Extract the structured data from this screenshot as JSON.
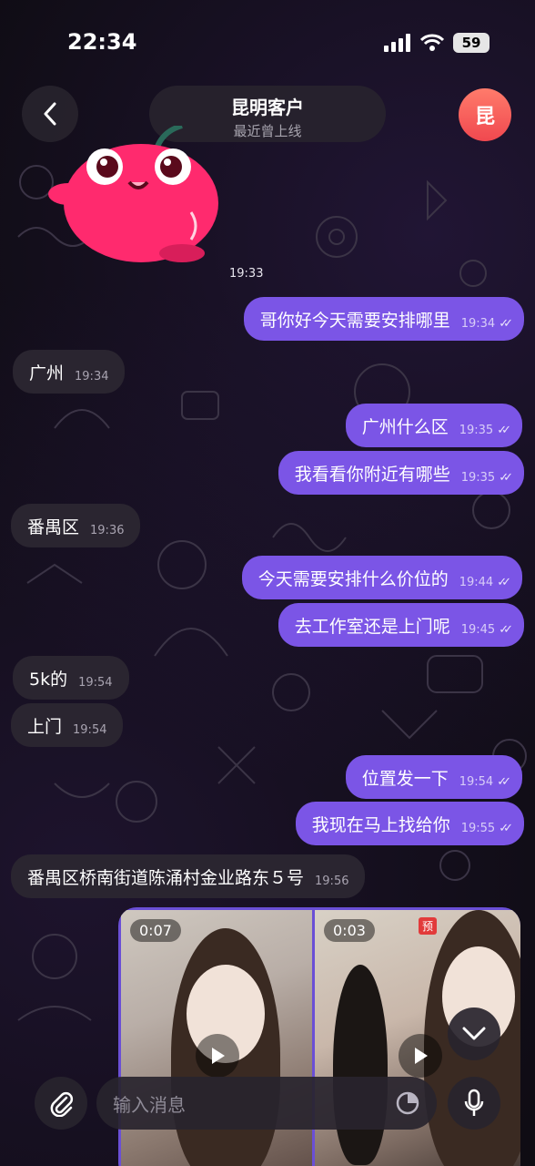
{
  "status_bar": {
    "time": "22:34",
    "battery": "59"
  },
  "header": {
    "title": "昆明客户",
    "subtitle": "最近曾上线",
    "avatar_letter": "昆"
  },
  "sticker": {
    "time": "19:33"
  },
  "messages": [
    {
      "dir": "out",
      "text": "哥你好今天需要安排哪里",
      "time": "19:34"
    },
    {
      "dir": "in",
      "text": "广州",
      "time": "19:34"
    },
    {
      "dir": "out",
      "text": "广州什么区",
      "time": "19:35"
    },
    {
      "dir": "out",
      "text": "我看看你附近有哪些",
      "time": "19:35"
    },
    {
      "dir": "in",
      "text": "番禺区",
      "time": "19:36"
    },
    {
      "dir": "out",
      "text": "今天需要安排什么价位的",
      "time": "19:44"
    },
    {
      "dir": "out",
      "text": "去工作室还是上门呢",
      "time": "19:45"
    },
    {
      "dir": "in",
      "text": "5k的",
      "time": "19:54"
    },
    {
      "dir": "in",
      "text": "上门",
      "time": "19:54"
    },
    {
      "dir": "out",
      "text": "位置发一下",
      "time": "19:54"
    },
    {
      "dir": "out",
      "text": "我现在马上找给你",
      "time": "19:55"
    },
    {
      "dir": "in",
      "text": "番禺区桥南街道陈涌村金业路东５号",
      "time": "19:56"
    }
  ],
  "videos": [
    {
      "duration": "0:07"
    },
    {
      "duration": "0:03",
      "badge": "预"
    }
  ],
  "input": {
    "placeholder": "输入消息"
  },
  "colors": {
    "outgoing": "#7b55e6",
    "incoming": "#2a2530",
    "background": "#0d0b10"
  }
}
